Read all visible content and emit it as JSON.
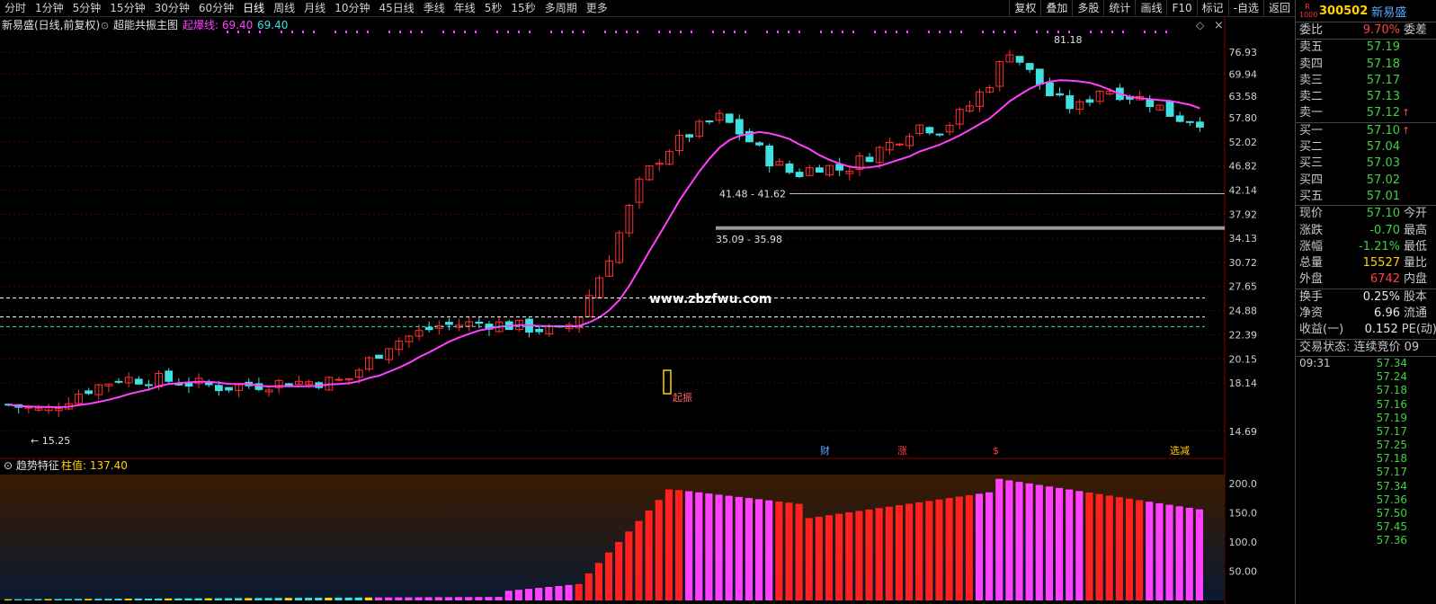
{
  "toolbar": {
    "periods": [
      "分时",
      "1分钟",
      "5分钟",
      "15分钟",
      "30分钟",
      "60分钟",
      "日线",
      "周线",
      "月线",
      "10分钟",
      "45日线",
      "季线",
      "年线",
      "5秒",
      "15秒",
      "多周期",
      "更多"
    ],
    "tools": [
      "复权",
      "叠加",
      "多股",
      "统计",
      "画线",
      "F10",
      "标记",
      "-自选",
      "返回"
    ]
  },
  "chart_header": {
    "title": "新易盛(日线,前复权)",
    "indicator": "超能共振主图",
    "line_label": "起爆线: 69.40",
    "line_value2": "69.40"
  },
  "sub_header": {
    "name": "趋势特征",
    "value_label": "柱值: 137.40"
  },
  "annotations": {
    "high": "81.18",
    "low": "15.25",
    "zone1": "41.48 - 41.62",
    "zone2": "35.09 - 35.98",
    "watermark": "www.zbzfwu.com",
    "start_label": "起振",
    "event_cai": "财",
    "event_zhang": "涨",
    "event_s": "$",
    "event_last": "选减"
  },
  "colors": {
    "up": "#ff3030",
    "down": "#40e0e0",
    "ma": "#ff40ff",
    "grid": "#5a0000",
    "axis": "#d0d0d0"
  },
  "chart_data": {
    "type": "candlestick",
    "y_ticks": [
      "76.93",
      "69.94",
      "63.58",
      "57.80",
      "52.02",
      "46.82",
      "42.14",
      "37.92",
      "34.13",
      "30.72",
      "27.65",
      "24.88",
      "22.39",
      "20.15",
      "18.14",
      "14.69"
    ],
    "sub_y_ticks": [
      "200.0",
      "150.0",
      "100.0",
      "50.00"
    ],
    "ylim": [
      14,
      82
    ],
    "log_scale": true,
    "high": 81.18,
    "low": 15.25,
    "zones": [
      [
        41.48,
        41.62
      ],
      [
        35.09,
        35.98
      ]
    ],
    "support_lines": [
      26.3,
      24.2,
      23.2
    ]
  },
  "side": {
    "code": "300502",
    "name": "新易盛",
    "logo": "R\n1000",
    "weibi": {
      "label": "委比",
      "value": "9.70%",
      "extra": "委差"
    },
    "asks": [
      {
        "label": "卖五",
        "price": "57.19"
      },
      {
        "label": "卖四",
        "price": "57.18"
      },
      {
        "label": "卖三",
        "price": "57.17"
      },
      {
        "label": "卖二",
        "price": "57.13"
      },
      {
        "label": "卖一",
        "price": "57.12",
        "arrow": "↑"
      }
    ],
    "bids": [
      {
        "label": "买一",
        "price": "57.10",
        "arrow": "↑"
      },
      {
        "label": "买二",
        "price": "57.04"
      },
      {
        "label": "买三",
        "price": "57.03"
      },
      {
        "label": "买四",
        "price": "57.02"
      },
      {
        "label": "买五",
        "price": "57.01"
      }
    ],
    "quote": [
      {
        "label": "现价",
        "value": "57.10",
        "extra": "今开",
        "cls": "green"
      },
      {
        "label": "涨跌",
        "value": "-0.70",
        "extra": "最高",
        "cls": "green"
      },
      {
        "label": "涨幅",
        "value": "-1.21%",
        "extra": "最低",
        "cls": "green"
      },
      {
        "label": "总量",
        "value": "15527",
        "extra": "量比",
        "cls": "yellow"
      },
      {
        "label": "外盘",
        "value": "6742",
        "extra": "内盘",
        "cls": "red"
      }
    ],
    "stats": [
      {
        "label": "换手",
        "value": "0.25%",
        "extra": "股本"
      },
      {
        "label": "净资",
        "value": "6.96",
        "extra": "流通"
      },
      {
        "label": "收益(一)",
        "value": "0.152",
        "extra": "PE(动)"
      }
    ],
    "status": "交易状态: 连续竞价 09",
    "ticks_time": "09:31",
    "ticks": [
      "57.34",
      "57.24",
      "57.18",
      "57.16",
      "57.19",
      "57.17",
      "57.25",
      "57.18",
      "57.17",
      "57.34",
      "57.36",
      "57.50",
      "57.45",
      "57.36"
    ]
  }
}
